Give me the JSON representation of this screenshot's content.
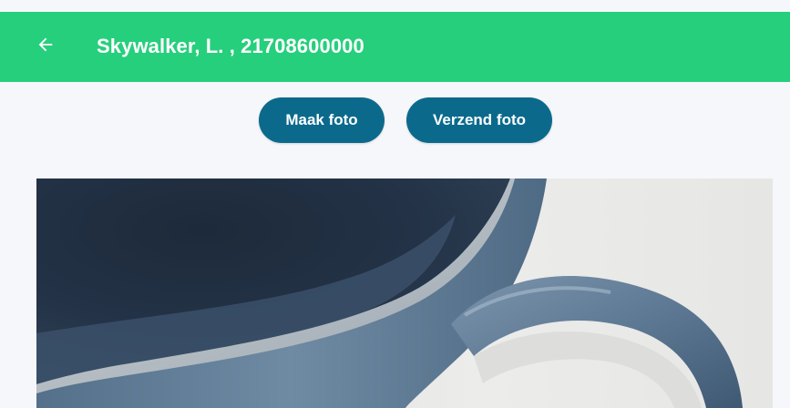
{
  "app_bar": {
    "back_icon": "arrow-left-icon",
    "title": "Skywalker, L. , 21708600000",
    "color": "#26cf7c"
  },
  "actions": {
    "take_photo_label": "Maak foto",
    "send_photo_label": "Verzend foto",
    "button_color": "#0b6a8c"
  },
  "photo": {
    "subject": "photo-preview"
  }
}
